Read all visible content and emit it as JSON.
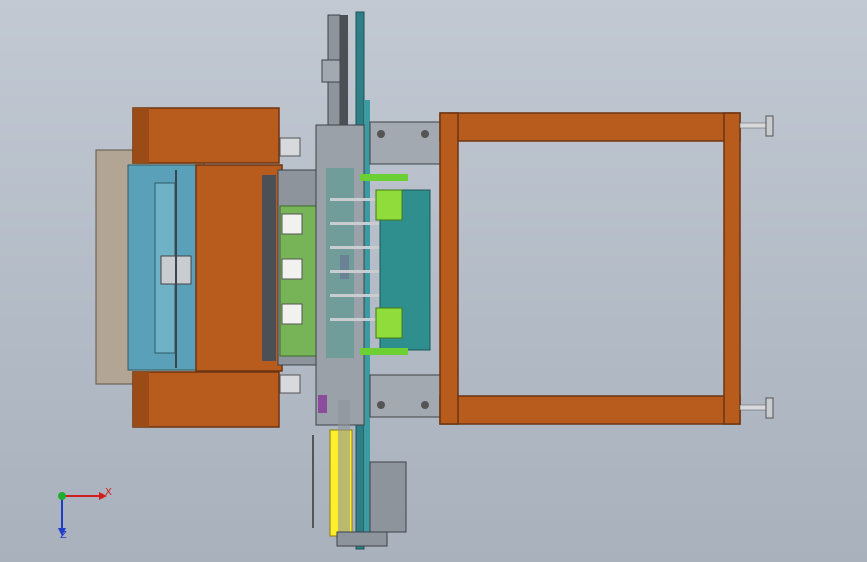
{
  "view": {
    "orientation_triad": {
      "x_label": "X",
      "z_label": "Z",
      "x_color": "#d11d1d",
      "y_color": "#1fae2e",
      "z_color": "#1f3cc8"
    }
  },
  "palette": {
    "background_top": "#c2c9d3",
    "background_bottom": "#a9b1bd",
    "orange_frame": "#b85c1e",
    "orange_dark": "#8d4214",
    "teal_plate": "#2f7f86",
    "teal_light": "#3c9aa0",
    "steel_gray": "#8d949c",
    "dark_gray": "#4b5057",
    "cyan_panel": "#5aa0b8",
    "tan_plate": "#b3a593",
    "green_part": "#8fdc3a",
    "yellow_part": "#ffef2a",
    "purple_part": "#8a4c9b",
    "white_block": "#f1f1ef",
    "pcb_green": "#76b457"
  }
}
